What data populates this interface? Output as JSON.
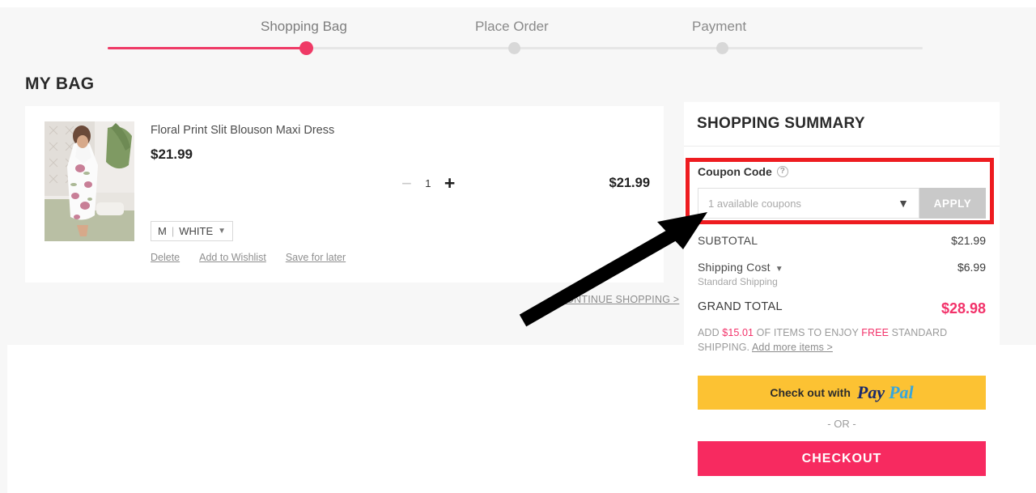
{
  "steps": {
    "items": [
      {
        "label": "Shopping Bag",
        "state": "active"
      },
      {
        "label": "Place Order",
        "state": "inactive"
      },
      {
        "label": "Payment",
        "state": "inactive"
      }
    ],
    "accent_color": "#ef3a66",
    "inactive_color": "#d8d8d8"
  },
  "page": {
    "title": "MY BAG"
  },
  "cart": {
    "item": {
      "title": "Floral Print Slit Blouson Maxi Dress",
      "price": "$21.99",
      "quantity": "1",
      "decrease_label": "−",
      "increase_label": "+",
      "line_total": "$21.99",
      "variant": {
        "size": "M",
        "separator": "|",
        "color": "WHITE",
        "chevron": "⌄"
      },
      "links": [
        {
          "label": "Delete"
        },
        {
          "label": "Add to Wishlist"
        },
        {
          "label": "Save for later"
        }
      ]
    },
    "continue_shopping": "CONTINUE SHOPPING >"
  },
  "summary": {
    "title": "SHOPPING SUMMARY",
    "coupon": {
      "label": "Coupon Code",
      "help_icon": "?",
      "placeholder": "1 available coupons",
      "chevron": "⌄",
      "apply_label": "APPLY"
    },
    "rows": [
      {
        "label": "SUBTOTAL",
        "value": "$21.99"
      },
      {
        "label": "Shipping Cost",
        "value": "$6.99",
        "note": "Standard Shipping"
      },
      {
        "label": "GRAND TOTAL",
        "value": "$28.98"
      }
    ],
    "free_shipping": {
      "prefix": "ADD ",
      "amount": "$15.01",
      "middle": " OF ITEMS TO ENJOY ",
      "free_word": "FREE",
      "suffix": " STANDARD SHIPPING. ",
      "link": "Add more items >"
    },
    "paypal": {
      "text": "Check out with",
      "brand_pay": "Pay",
      "brand_pal": "Pal"
    },
    "or_separator": "- OR -",
    "checkout_label": "CHECKOUT"
  },
  "annotations": {
    "highlight_box_color": "#ee1c20",
    "arrow_color": "#000000"
  }
}
